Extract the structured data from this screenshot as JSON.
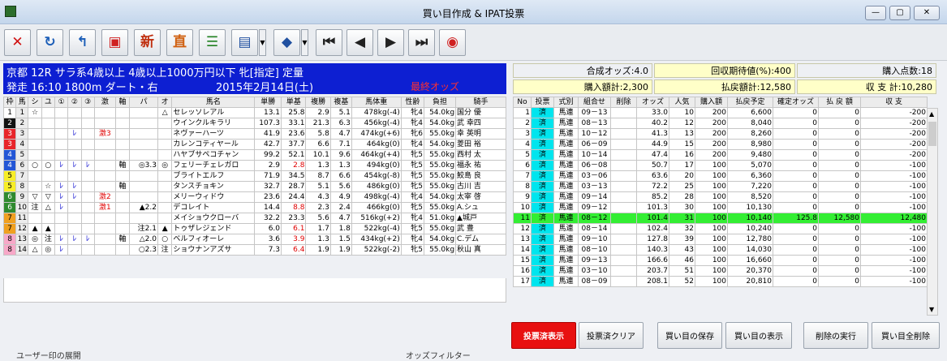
{
  "window": {
    "title": "買い目作成 & IPAT投票"
  },
  "toolbar": {
    "icons": [
      {
        "name": "close-icon",
        "glyph": "✕",
        "color": "#d01010"
      },
      {
        "name": "refresh-icon",
        "glyph": "↻",
        "color": "#1d5fb8"
      },
      {
        "name": "return-icon",
        "glyph": "↰",
        "color": "#1d5fb8"
      },
      {
        "name": "odds-icon",
        "glyph": "▣",
        "color": "#d02020"
      },
      {
        "name": "newspaper-icon",
        "glyph": "新",
        "color": "#c03010"
      },
      {
        "name": "prior-icon",
        "glyph": "直",
        "color": "#d06010"
      },
      {
        "name": "list-icon",
        "glyph": "☰",
        "color": "#208020"
      },
      {
        "name": "form-icon",
        "glyph": "▤",
        "color": "#2050a0"
      },
      {
        "name": "vote-icon",
        "glyph": "◆",
        "color": "#2050a0"
      },
      {
        "name": "first-icon",
        "glyph": "⏮",
        "color": "#222"
      },
      {
        "name": "prev-icon",
        "glyph": "◀",
        "color": "#222"
      },
      {
        "name": "next-icon",
        "glyph": "▶",
        "color": "#222"
      },
      {
        "name": "last-icon",
        "glyph": "⏭",
        "color": "#222"
      },
      {
        "name": "ipat-icon",
        "glyph": "◉",
        "color": "#d02020"
      }
    ]
  },
  "race": {
    "line1": "京都  12R  サラ系4歳以上  4歳以上1000万円以下  牝[指定]  定量",
    "start": "発走  16:10  1800m  ダート・右",
    "date": "2015年2月14日(土)",
    "odds_status": "最終オッズ"
  },
  "summary": {
    "composite": "合成オッズ:4.0",
    "recovery": "回収期待値(%):400",
    "points": "購入点数:18",
    "purchase": "購入額計:2,300",
    "refund": "払戻額計:12,580",
    "balance": "収  支  計:10,280"
  },
  "horses": {
    "headers": [
      "枠",
      "馬",
      "シ",
      "ユ",
      "①",
      "②",
      "③",
      "激",
      "軸",
      "パ",
      "オ",
      "馬名",
      "単勝",
      "単基",
      "複勝",
      "複基",
      "馬体重",
      "性齢",
      "負担",
      "騎手"
    ],
    "rows": [
      {
        "w": "1",
        "wc": "w1",
        "n": "1",
        "s": "☆",
        "y": "",
        "m1": "",
        "m2": "",
        "m3": "",
        "g": "",
        "j": "",
        "p": "",
        "o": "△",
        "name": "セレッソレアル",
        "t": "13.1",
        "tk": "25.8",
        "f": "2.9",
        "fk": "5.1",
        "wt": "478kg(-4)",
        "sa": "牝4",
        "kg": "54.0kg",
        "jk": "国分 優",
        "red": false
      },
      {
        "w": "2",
        "wc": "w2",
        "n": "2",
        "s": "",
        "y": "",
        "m1": "",
        "m2": "",
        "m3": "",
        "g": "",
        "j": "",
        "p": "",
        "o": "",
        "name": "ウインクルキラリ",
        "t": "107.3",
        "tk": "33.1",
        "f": "21.3",
        "fk": "6.3",
        "wt": "456kg(-4)",
        "sa": "牝4",
        "kg": "54.0kg",
        "jk": "武 幸四",
        "red": false
      },
      {
        "w": "3",
        "wc": "w3",
        "n": "3",
        "s": "",
        "y": "",
        "m1": "",
        "m2": "ﾚ",
        "m3": "",
        "g": "激3",
        "j": "",
        "p": "",
        "o": "",
        "name": "ネヴァーハーツ",
        "t": "41.9",
        "tk": "23.6",
        "f": "5.8",
        "fk": "4.7",
        "wt": "474kg(+6)",
        "sa": "牝6",
        "kg": "55.0kg",
        "jk": "幸 英明",
        "red": false
      },
      {
        "w": "3",
        "wc": "w3",
        "n": "4",
        "s": "",
        "y": "",
        "m1": "",
        "m2": "",
        "m3": "",
        "g": "",
        "j": "",
        "p": "",
        "o": "",
        "name": "カレンコティヤール",
        "t": "42.7",
        "tk": "37.7",
        "f": "6.6",
        "fk": "7.1",
        "wt": "464kg(0)",
        "sa": "牝4",
        "kg": "54.0kg",
        "jk": "菱田 裕",
        "red": false
      },
      {
        "w": "4",
        "wc": "w4",
        "n": "5",
        "s": "",
        "y": "",
        "m1": "",
        "m2": "",
        "m3": "",
        "g": "",
        "j": "",
        "p": "",
        "o": "",
        "name": "ハヤブサペコチャン",
        "t": "99.2",
        "tk": "52.1",
        "f": "10.1",
        "fk": "9.6",
        "wt": "464kg(+4)",
        "sa": "牝5",
        "kg": "55.0kg",
        "jk": "西村 太",
        "red": false
      },
      {
        "w": "4",
        "wc": "w4",
        "n": "6",
        "s": "○",
        "y": "○",
        "m1": "ﾚ",
        "m2": "ﾚ",
        "m3": "ﾚ",
        "g": "",
        "j": "軸",
        "p": "◎3.3",
        "o": "◎",
        "name": "フェリーチェレガロ",
        "t": "2.9",
        "tk": "2.8",
        "f": "1.3",
        "fk": "1.3",
        "wt": "494kg(0)",
        "sa": "牝5",
        "kg": "55.0kg",
        "jk": "福永 祐",
        "red": true
      },
      {
        "w": "5",
        "wc": "w5",
        "n": "7",
        "s": "",
        "y": "",
        "m1": "",
        "m2": "",
        "m3": "",
        "g": "",
        "j": "",
        "p": "",
        "o": "",
        "name": "ブライトエルフ",
        "t": "71.9",
        "tk": "34.5",
        "f": "8.7",
        "fk": "6.6",
        "wt": "454kg(-8)",
        "sa": "牝5",
        "kg": "55.0kg",
        "jk": "鮫島 良",
        "red": false
      },
      {
        "w": "5",
        "wc": "w5",
        "n": "8",
        "s": "",
        "y": "☆",
        "m1": "ﾚ",
        "m2": "ﾚ",
        "m3": "",
        "g": "",
        "j": "軸",
        "p": "",
        "o": "",
        "name": "タンスチョキン",
        "t": "32.7",
        "tk": "28.7",
        "f": "5.1",
        "fk": "5.6",
        "wt": "486kg(0)",
        "sa": "牝5",
        "kg": "55.0kg",
        "jk": "古川 吉",
        "red": false
      },
      {
        "w": "6",
        "wc": "w6",
        "n": "9",
        "s": "▽",
        "y": "▽",
        "m1": "ﾚ",
        "m2": "ﾚ",
        "m3": "",
        "g": "激2",
        "j": "",
        "p": "",
        "o": "",
        "name": "メリーウィドウ",
        "t": "23.6",
        "tk": "24.4",
        "f": "4.3",
        "fk": "4.9",
        "wt": "498kg(-4)",
        "sa": "牝4",
        "kg": "54.0kg",
        "jk": "太宰 啓",
        "red": false
      },
      {
        "w": "6",
        "wc": "w6",
        "n": "10",
        "s": "注",
        "y": "△",
        "m1": "ﾚ",
        "m2": "",
        "m3": "",
        "g": "激1",
        "j": "",
        "p": "▲2.2",
        "o": "",
        "name": "デコレイト",
        "t": "14.4",
        "tk": "8.8",
        "f": "2.3",
        "fk": "2.4",
        "wt": "466kg(0)",
        "sa": "牝5",
        "kg": "55.0kg",
        "jk": "A.シュ",
        "red": true
      },
      {
        "w": "7",
        "wc": "w7",
        "n": "11",
        "s": "",
        "y": "",
        "m1": "",
        "m2": "",
        "m3": "",
        "g": "",
        "j": "",
        "p": "",
        "o": "",
        "name": "メイショウクローバ",
        "t": "32.2",
        "tk": "23.3",
        "f": "5.6",
        "fk": "4.7",
        "wt": "516kg(+2)",
        "sa": "牝4",
        "kg": "51.0kg",
        "jk": "▲城戸",
        "red": false
      },
      {
        "w": "7",
        "wc": "w7",
        "n": "12",
        "s": "▲",
        "y": "▲",
        "m1": "",
        "m2": "",
        "m3": "",
        "g": "",
        "j": "",
        "p": "注2.1",
        "o": "▲",
        "name": "トゥザレジェンド",
        "t": "6.0",
        "tk": "6.1",
        "f": "1.7",
        "fk": "1.8",
        "wt": "522kg(-4)",
        "sa": "牝5",
        "kg": "55.0kg",
        "jk": "武 豊",
        "red": true
      },
      {
        "w": "8",
        "wc": "w8",
        "n": "13",
        "s": "◎",
        "y": "注",
        "m1": "ﾚ",
        "m2": "ﾚ",
        "m3": "ﾚ",
        "g": "",
        "j": "軸",
        "p": "△2.0",
        "o": "○",
        "name": "ベルフィオーレ",
        "t": "3.6",
        "tk": "3.9",
        "f": "1.3",
        "fk": "1.5",
        "wt": "434kg(+2)",
        "sa": "牝4",
        "kg": "54.0kg",
        "jk": "C.デム",
        "red": true
      },
      {
        "w": "8",
        "wc": "w8",
        "n": "14",
        "s": "△",
        "y": "◎",
        "m1": "ﾚ",
        "m2": "",
        "m3": "",
        "g": "",
        "j": "",
        "p": "○2.3",
        "o": "注",
        "name": "ショウナンアズサ",
        "t": "7.3",
        "tk": "6.4",
        "f": "1.9",
        "fk": "1.9",
        "wt": "522kg(-2)",
        "sa": "牝5",
        "kg": "55.0kg",
        "jk": "秋山 真",
        "red": true
      }
    ]
  },
  "bets": {
    "headers": [
      "No",
      "投票",
      "式別",
      "組合せ",
      "削除",
      "オッズ",
      "人気",
      "購入額",
      "払戻予定",
      "確定オッズ",
      "払 戻 額",
      "収  支"
    ],
    "rows": [
      {
        "no": "1",
        "v": "済",
        "k": "馬連",
        "c": "09－13",
        "d": "",
        "o": "33.0",
        "p": "10",
        "b": "200",
        "e": "6,600",
        "fo": "0",
        "r": "0",
        "pl": "-200",
        "hl": false
      },
      {
        "no": "2",
        "v": "済",
        "k": "馬連",
        "c": "08－13",
        "d": "",
        "o": "40.2",
        "p": "12",
        "b": "200",
        "e": "8,040",
        "fo": "0",
        "r": "0",
        "pl": "-200",
        "hl": false
      },
      {
        "no": "3",
        "v": "済",
        "k": "馬連",
        "c": "10－12",
        "d": "",
        "o": "41.3",
        "p": "13",
        "b": "200",
        "e": "8,260",
        "fo": "0",
        "r": "0",
        "pl": "-200",
        "hl": false
      },
      {
        "no": "4",
        "v": "済",
        "k": "馬連",
        "c": "06－09",
        "d": "",
        "o": "44.9",
        "p": "15",
        "b": "200",
        "e": "8,980",
        "fo": "0",
        "r": "0",
        "pl": "-200",
        "hl": false
      },
      {
        "no": "5",
        "v": "済",
        "k": "馬連",
        "c": "10－14",
        "d": "",
        "o": "47.4",
        "p": "16",
        "b": "200",
        "e": "9,480",
        "fo": "0",
        "r": "0",
        "pl": "-200",
        "hl": false
      },
      {
        "no": "6",
        "v": "済",
        "k": "馬連",
        "c": "06－08",
        "d": "",
        "o": "50.7",
        "p": "17",
        "b": "100",
        "e": "5,070",
        "fo": "0",
        "r": "0",
        "pl": "-100",
        "hl": false
      },
      {
        "no": "7",
        "v": "済",
        "k": "馬連",
        "c": "03－06",
        "d": "",
        "o": "63.6",
        "p": "20",
        "b": "100",
        "e": "6,360",
        "fo": "0",
        "r": "0",
        "pl": "-100",
        "hl": false
      },
      {
        "no": "8",
        "v": "済",
        "k": "馬連",
        "c": "03－13",
        "d": "",
        "o": "72.2",
        "p": "25",
        "b": "100",
        "e": "7,220",
        "fo": "0",
        "r": "0",
        "pl": "-100",
        "hl": false
      },
      {
        "no": "9",
        "v": "済",
        "k": "馬連",
        "c": "09－14",
        "d": "",
        "o": "85.2",
        "p": "28",
        "b": "100",
        "e": "8,520",
        "fo": "0",
        "r": "0",
        "pl": "-100",
        "hl": false
      },
      {
        "no": "10",
        "v": "済",
        "k": "馬連",
        "c": "09－12",
        "d": "",
        "o": "101.3",
        "p": "30",
        "b": "100",
        "e": "10,130",
        "fo": "0",
        "r": "0",
        "pl": "-100",
        "hl": false
      },
      {
        "no": "11",
        "v": "済",
        "k": "馬連",
        "c": "08－12",
        "d": "",
        "o": "101.4",
        "p": "31",
        "b": "100",
        "e": "10,140",
        "fo": "125.8",
        "r": "12,580",
        "pl": "12,480",
        "hl": true
      },
      {
        "no": "12",
        "v": "済",
        "k": "馬連",
        "c": "08－14",
        "d": "",
        "o": "102.4",
        "p": "32",
        "b": "100",
        "e": "10,240",
        "fo": "0",
        "r": "0",
        "pl": "-100",
        "hl": false
      },
      {
        "no": "13",
        "v": "済",
        "k": "馬連",
        "c": "09－10",
        "d": "",
        "o": "127.8",
        "p": "39",
        "b": "100",
        "e": "12,780",
        "fo": "0",
        "r": "0",
        "pl": "-100",
        "hl": false
      },
      {
        "no": "14",
        "v": "済",
        "k": "馬連",
        "c": "08－10",
        "d": "",
        "o": "140.3",
        "p": "43",
        "b": "100",
        "e": "14,030",
        "fo": "0",
        "r": "0",
        "pl": "-100",
        "hl": false
      },
      {
        "no": "15",
        "v": "済",
        "k": "馬連",
        "c": "09－13",
        "d": "",
        "o": "166.6",
        "p": "46",
        "b": "100",
        "e": "16,660",
        "fo": "0",
        "r": "0",
        "pl": "-100",
        "hl": false
      },
      {
        "no": "16",
        "v": "済",
        "k": "馬連",
        "c": "03－10",
        "d": "",
        "o": "203.7",
        "p": "51",
        "b": "100",
        "e": "20,370",
        "fo": "0",
        "r": "0",
        "pl": "-100",
        "hl": false
      },
      {
        "no": "17",
        "v": "済",
        "k": "馬連",
        "c": "08－09",
        "d": "",
        "o": "208.1",
        "p": "52",
        "b": "100",
        "e": "20,810",
        "fo": "0",
        "r": "0",
        "pl": "-100",
        "hl": false
      }
    ]
  },
  "buttons": {
    "voted_show": "投票済表示",
    "voted_clear": "投票済クリア",
    "save": "買い目の保存",
    "show": "買い目の表示",
    "delete_exec": "削除の実行",
    "delete_all": "買い目全削除"
  },
  "groups": {
    "user_marks": "ユーザー印の展開",
    "odds_filter": "オッズフィルター"
  }
}
